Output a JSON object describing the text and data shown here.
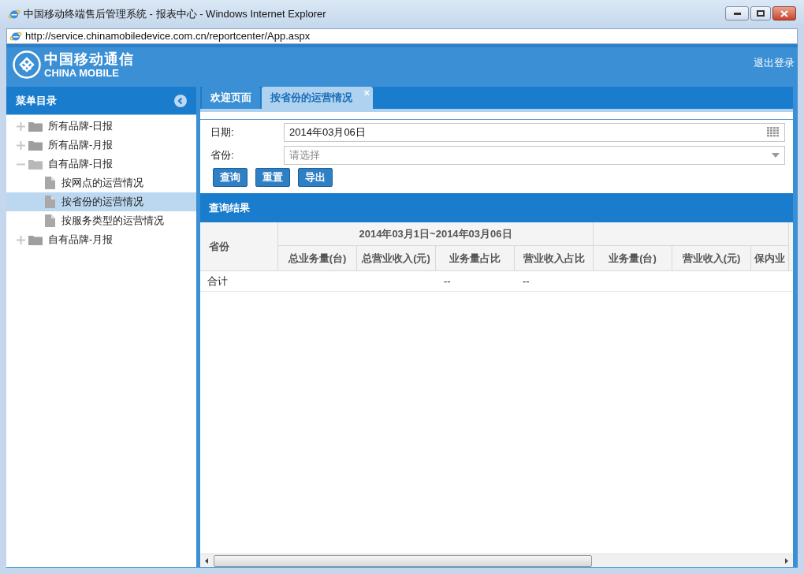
{
  "window": {
    "title": "中国移动终端售后管理系统 - 报表中心 - Windows Internet Explorer",
    "address": "http://service.chinamobiledevice.com.cn/reportcenter/App.aspx"
  },
  "header": {
    "logo_cn": "中国移动通信",
    "logo_en": "CHINA MOBILE",
    "logout": "退出登录"
  },
  "sidebar": {
    "title": "菜单目录",
    "items": [
      {
        "label": "所有品牌-日报",
        "expanded": false
      },
      {
        "label": "所有品牌-月报",
        "expanded": false
      },
      {
        "label": "自有品牌-日报",
        "expanded": true,
        "children": [
          {
            "label": "按网点的运营情况",
            "selected": false
          },
          {
            "label": "按省份的运营情况",
            "selected": true
          },
          {
            "label": "按服务类型的运营情况",
            "selected": false
          }
        ]
      },
      {
        "label": "自有品牌-月报",
        "expanded": false
      }
    ]
  },
  "tabs": [
    {
      "label": "欢迎页面",
      "selected": false
    },
    {
      "label": "按省份的运营情况",
      "selected": true,
      "close": "×"
    }
  ],
  "form": {
    "fields": [
      {
        "kind": "date",
        "label": "日期:",
        "value": "2014年03月06日"
      },
      {
        "kind": "select",
        "label": "省份:",
        "placeholder": "请选择"
      }
    ],
    "buttons": [
      "查询",
      "重置",
      "导出"
    ]
  },
  "results": {
    "title": "查询结果",
    "table": {
      "row_header": "省份",
      "groups": [
        {
          "label": "2014年03月1日~2014年03月06日",
          "columns": [
            "总业务量(台)",
            "总营业收入(元)",
            "业务量占比",
            "营业收入占比"
          ]
        },
        {
          "columns": [
            "业务量(台)",
            "营业收入(元)",
            "保内业"
          ]
        }
      ],
      "rows": [
        {
          "label": "合计",
          "cells": [
            null,
            null,
            "--",
            "--",
            null,
            null,
            null
          ]
        }
      ]
    }
  }
}
